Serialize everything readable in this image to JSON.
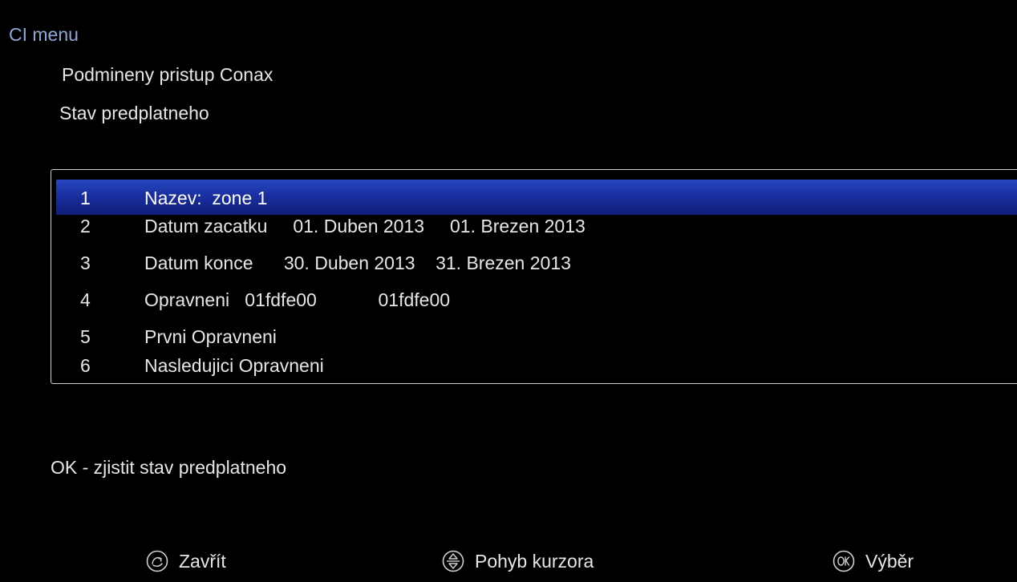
{
  "header": {
    "menu_title": "CI menu",
    "subtitle_1": "Podmineny pristup Conax",
    "subtitle_2": "Stav predplatneho"
  },
  "list": {
    "rows": [
      {
        "num": "1",
        "label": "Nazev:  zone 1",
        "selected": true
      },
      {
        "num": "2",
        "label": "Datum zacatku     01. Duben 2013     01. Brezen 2013",
        "selected": false
      },
      {
        "num": "3",
        "label": "Datum konce      30. Duben 2013    31. Brezen 2013",
        "selected": false
      },
      {
        "num": "4",
        "label": "Opravneni   01fdfe00            01fdfe00",
        "selected": false
      },
      {
        "num": "5",
        "label": "Prvni Opravneni",
        "selected": false
      },
      {
        "num": "6",
        "label": "Nasledujici Opravneni",
        "selected": false
      }
    ]
  },
  "hint": "OK - zjistit stav predplatneho",
  "footer": {
    "close_label": "Zavřít",
    "close_icon": "exit-icon",
    "cursor_label": "Pohyb kurzora",
    "cursor_icon": "arrows-icon",
    "select_label": "Výběr",
    "select_icon": "ok-icon"
  },
  "colors": {
    "background": "#000000",
    "title": "#8fa6d8",
    "text": "#e6e6e6",
    "selection": "#1a2fa0",
    "border": "#cfcfcf"
  }
}
